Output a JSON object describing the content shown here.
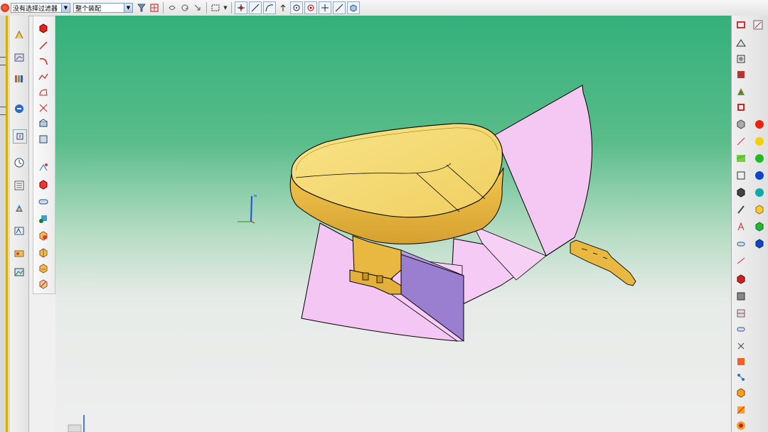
{
  "toolbar": {
    "filter_combo_value": "没有选择过滤器",
    "assembly_combo_value": "整个装配"
  },
  "viewport": {
    "colors": {
      "sheet_pink": "#f4c5f4",
      "seat_yellow": "#f5d46a",
      "block_purple": "#9b7fd0",
      "edge": "#000000"
    }
  },
  "icons": {
    "top": [
      "select-filter-icon",
      "snap-icon",
      "undo-icon",
      "rotate-icon",
      "zoom-icon",
      "fit-view-icon",
      "select-box-icon",
      "snap-point-icon",
      "line-icon",
      "curve-icon",
      "circle-icon",
      "point-icon",
      "cross-icon",
      "diagonal-icon",
      "cube-icon"
    ],
    "left_primary": [
      "sketch-icon",
      "curve-tool-icon",
      "part-icon",
      "drafting-icon",
      "measure-icon",
      "view-icon",
      "history-icon",
      "layers-icon",
      "assembly-icon",
      "color-icon",
      "render-icon"
    ],
    "left_secondary": [
      "block-icon",
      "line-icon",
      "arc-icon",
      "spline-icon",
      "offset-icon",
      "trim-icon",
      "fillet-icon",
      "chamfer-icon",
      "pattern-icon",
      "mirror-icon",
      "extrude-icon",
      "revolve-icon",
      "sweep-icon",
      "shell-icon",
      "boolean-icon",
      "sew-icon"
    ],
    "right": [
      "section-icon",
      "edit-icon",
      "shade-icon",
      "wireframe-icon",
      "hidden-line-icon",
      "texture-icon",
      "studio-icon",
      "material-icon",
      "red-color-icon",
      "yellow-color-icon",
      "green-color-icon",
      "blue-color-icon",
      "text-icon",
      "light-icon",
      "camera-icon",
      "scene-icon",
      "export-icon"
    ]
  }
}
